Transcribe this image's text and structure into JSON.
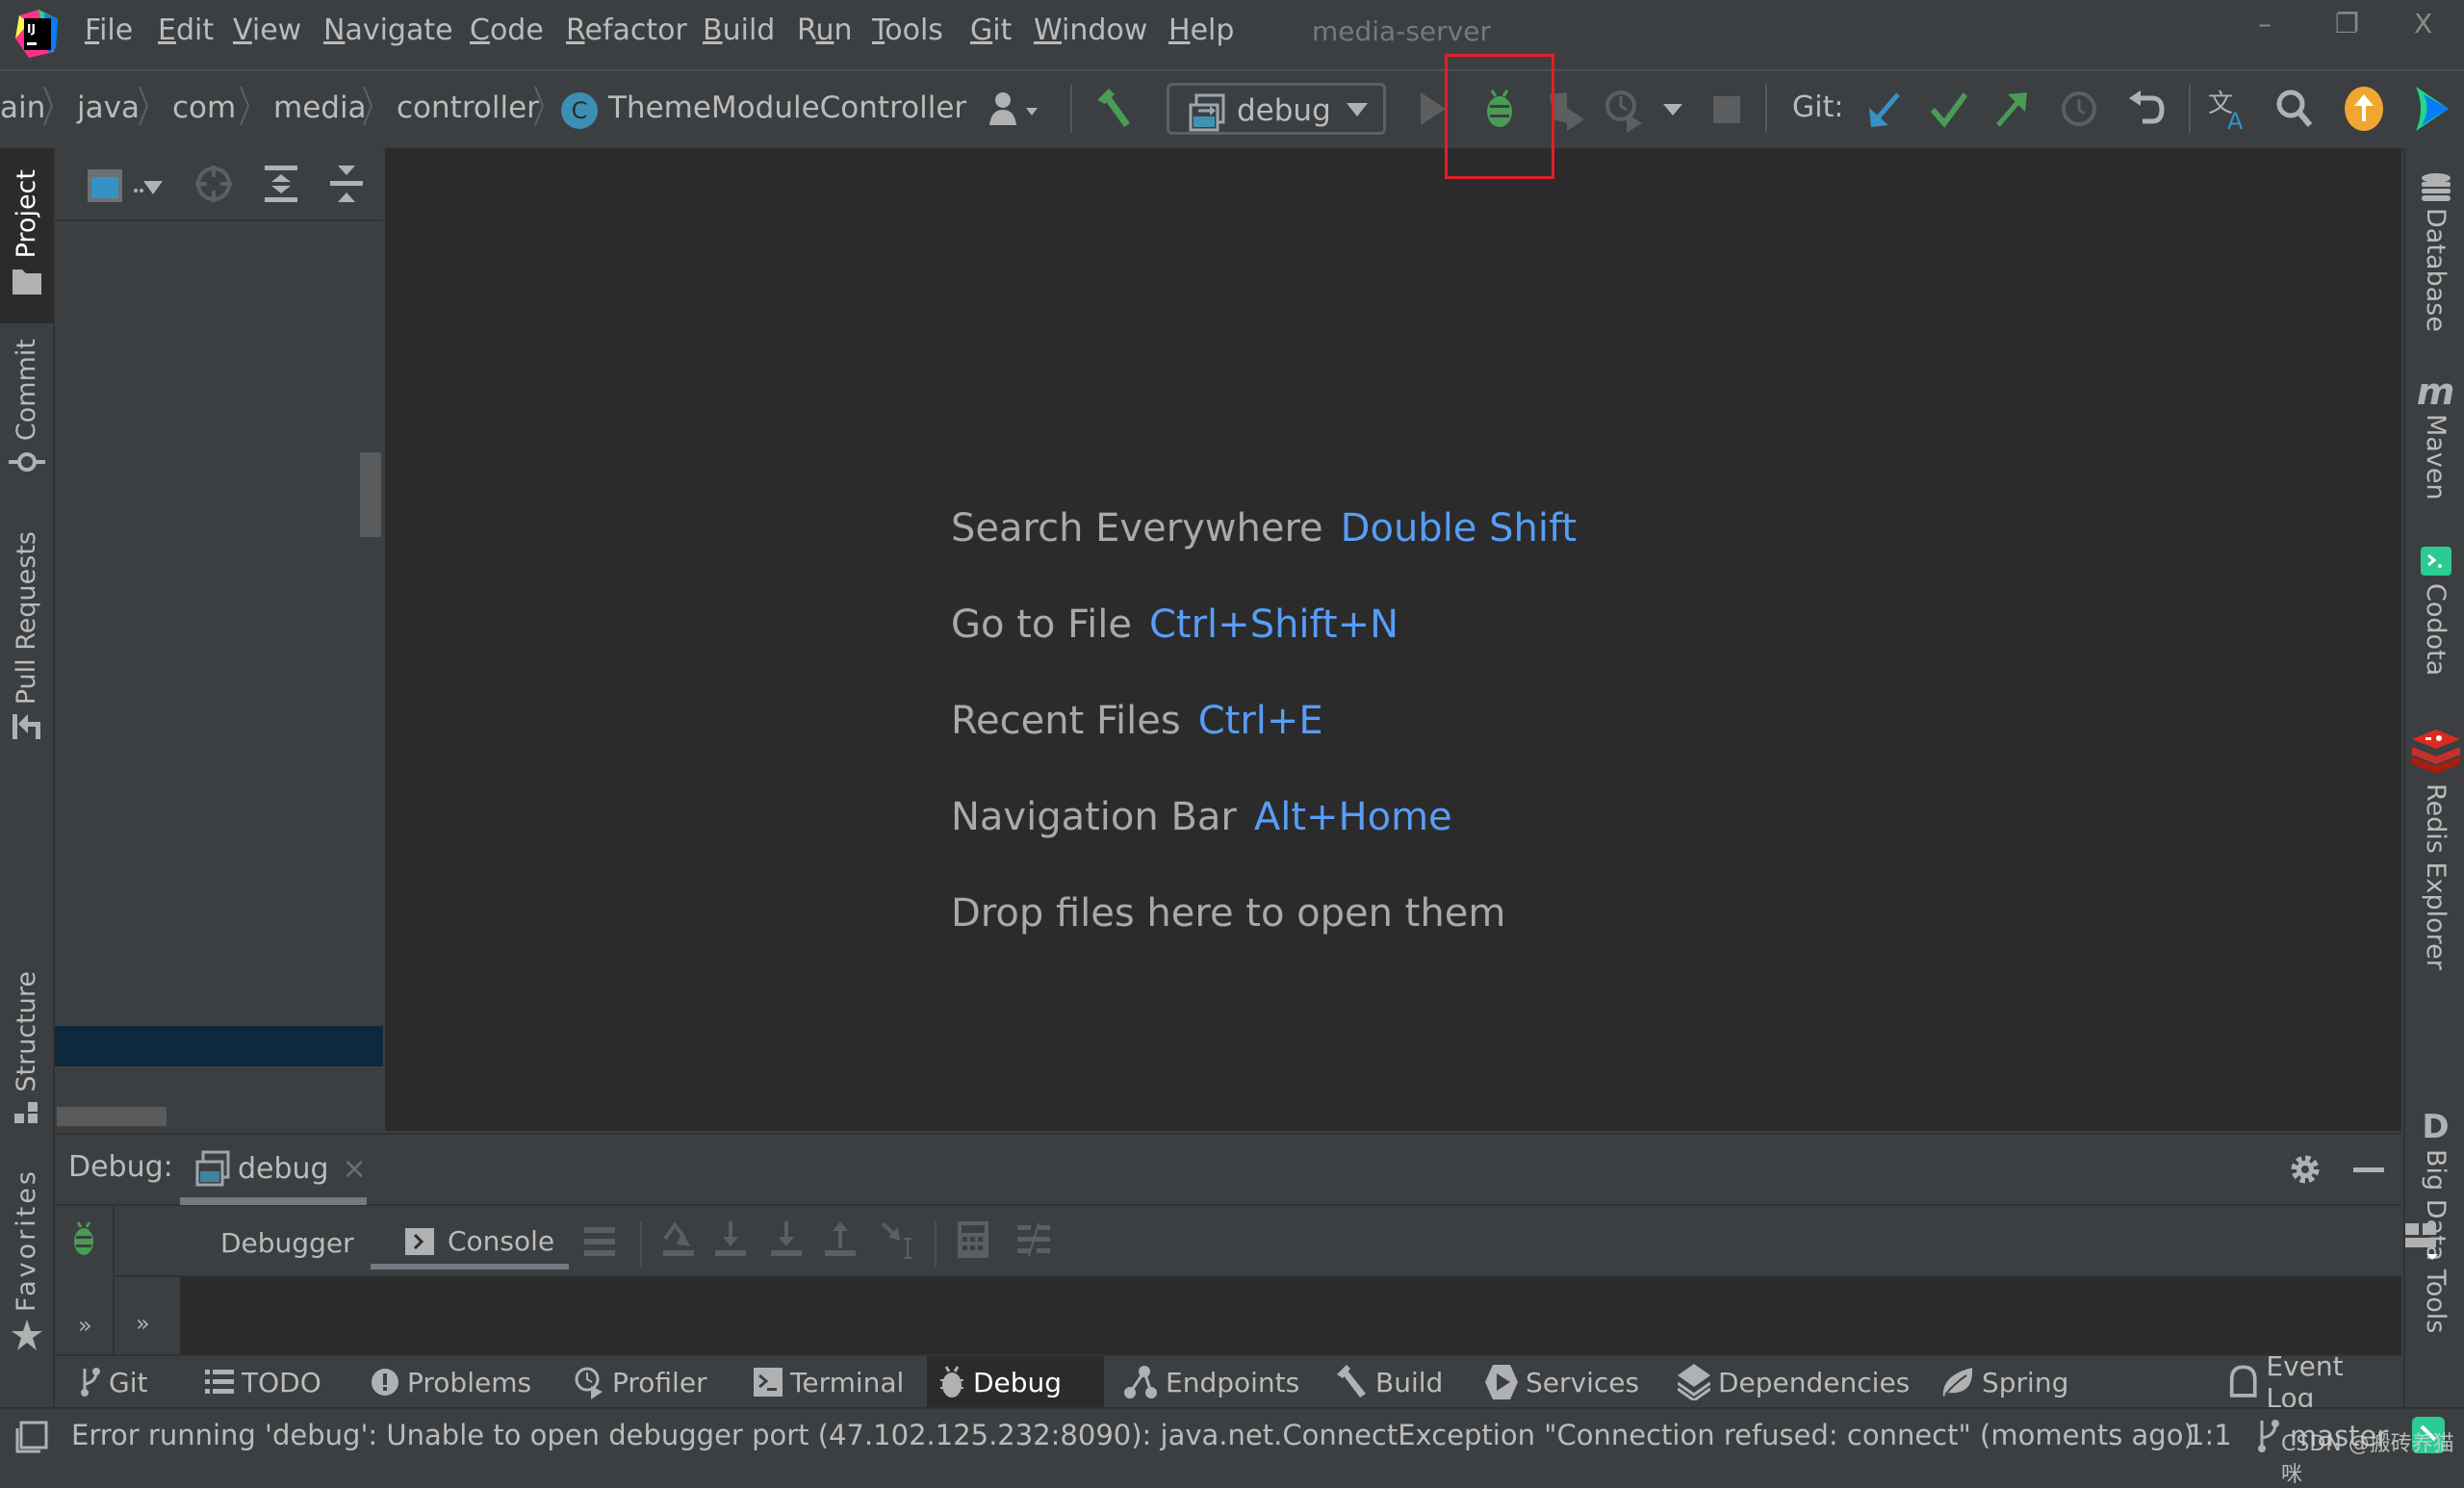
{
  "menubar": {
    "items": [
      {
        "label": "File",
        "mnemonic": "F",
        "rest": "ile"
      },
      {
        "label": "Edit",
        "mnemonic": "E",
        "rest": "dit"
      },
      {
        "label": "View",
        "mnemonic": "V",
        "rest": "iew"
      },
      {
        "label": "Navigate",
        "mnemonic": "N",
        "rest": "avigate"
      },
      {
        "label": "Code",
        "mnemonic": "C",
        "rest": "ode"
      },
      {
        "label": "Refactor",
        "mnemonic": "R",
        "rest": "efactor"
      },
      {
        "label": "Build",
        "mnemonic": "B",
        "rest": "uild"
      },
      {
        "label": "Run",
        "pre": "R",
        "mnemonic": "u",
        "rest": "n"
      },
      {
        "label": "Tools",
        "mnemonic": "T",
        "rest": "ools"
      },
      {
        "label": "Git",
        "mnemonic": "G",
        "rest": "it"
      },
      {
        "label": "Window",
        "mnemonic": "W",
        "rest": "indow"
      },
      {
        "label": "Help",
        "mnemonic": "H",
        "rest": "elp"
      }
    ],
    "window_title": "media-server",
    "window_controls": {
      "minimize": "–",
      "restore": "❐",
      "close": "X"
    }
  },
  "breadcrumbs": [
    "ain",
    "java",
    "com",
    "media",
    "controller",
    "ThemeModuleController"
  ],
  "breadcrumb_class_badge": "C",
  "toolbar": {
    "run_config": "debug",
    "git_label": "Git:",
    "highlighted": "debug-button"
  },
  "left_strip": {
    "tabs": [
      "Project",
      "Commit",
      "Pull Requests",
      "Structure",
      "Favorites"
    ]
  },
  "right_strip": {
    "tabs": [
      "Database",
      "Maven",
      "Codota",
      "Redis Explorer",
      "Big Data Tools"
    ],
    "maven_glyph": "m",
    "bigdata_glyph": "D"
  },
  "editor": {
    "hints": [
      {
        "label": "Search Everywhere",
        "shortcut": "Double Shift"
      },
      {
        "label": "Go to File",
        "shortcut": "Ctrl+Shift+N"
      },
      {
        "label": "Recent Files",
        "shortcut": "Ctrl+E"
      },
      {
        "label": "Navigation Bar",
        "shortcut": "Alt+Home"
      },
      {
        "label": "Drop files here to open them",
        "shortcut": ""
      }
    ]
  },
  "debug_panel": {
    "title": "Debug:",
    "session_tab": "debug",
    "close": "×",
    "tabs": [
      "Debugger",
      "Console"
    ],
    "active_tab": "Console",
    "more": "»"
  },
  "bottom_tabs": [
    {
      "label": "Git",
      "icon": "git-branch-icon"
    },
    {
      "label": "TODO",
      "icon": "list-icon"
    },
    {
      "label": "Problems",
      "icon": "problems-icon"
    },
    {
      "label": "Profiler",
      "icon": "profiler-icon"
    },
    {
      "label": "Terminal",
      "icon": "terminal-icon"
    },
    {
      "label": "Debug",
      "icon": "bug-icon",
      "active": true
    },
    {
      "label": "Endpoints",
      "icon": "endpoints-icon"
    },
    {
      "label": "Build",
      "icon": "hammer-icon"
    },
    {
      "label": "Services",
      "icon": "services-icon"
    },
    {
      "label": "Dependencies",
      "icon": "dependencies-icon"
    },
    {
      "label": "Spring",
      "icon": "spring-leaf-icon"
    },
    {
      "label": "Event Log",
      "icon": "event-log-icon"
    }
  ],
  "statusbar": {
    "message": "Error running 'debug': Unable to open debugger port (47.102.125.232:8090): java.net.ConnectException \"Connection refused: connect\" (moments ago)",
    "position": "1:1",
    "branch": "master",
    "watermark": "CSDN @搬砖养猫咪"
  },
  "colors": {
    "accent_link": "#589df6",
    "green_icon": "#499c54",
    "highlight_box": "#e0202a",
    "git_update": "#3592c4",
    "selection": "#0d293e"
  }
}
